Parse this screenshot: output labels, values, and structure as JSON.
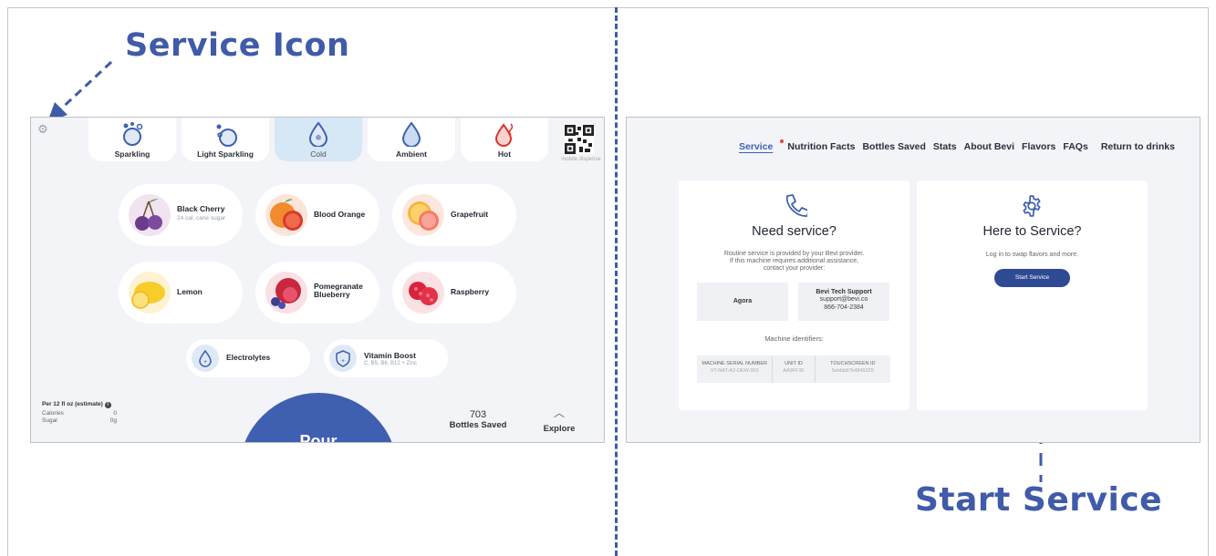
{
  "callouts": {
    "service_icon": "Service Icon",
    "start_service": "Start Service"
  },
  "left_screen": {
    "temperatures": [
      {
        "label": "Sparkling",
        "icon": "sparkling-bubbles-icon"
      },
      {
        "label": "Light Sparkling",
        "icon": "light-sparkling-bubbles-icon"
      },
      {
        "label": "Cold",
        "icon": "cold-drop-icon"
      },
      {
        "label": "Ambient",
        "icon": "ambient-drop-icon"
      },
      {
        "label": "Hot",
        "icon": "hot-drop-icon"
      }
    ],
    "selected_temperature": "Cold",
    "qr_caption": "mobile dispense",
    "flavors": [
      {
        "name": "Black Cherry",
        "sub": "24 cal, cane sugar"
      },
      {
        "name": "Blood Orange",
        "sub": ""
      },
      {
        "name": "Grapefruit",
        "sub": ""
      },
      {
        "name": "Lemon",
        "sub": ""
      },
      {
        "name": "Pomegranate Blueberry",
        "sub": ""
      },
      {
        "name": "Raspberry",
        "sub": ""
      }
    ],
    "boosts": [
      {
        "name": "Electrolytes",
        "sub": ""
      },
      {
        "name": "Vitamin Boost",
        "sub": "C, B5, B6, B12 + Zinc"
      }
    ],
    "nutrition": {
      "header": "Per 12 fl oz (estimate)",
      "rows": [
        {
          "label": "Calories",
          "value": "0"
        },
        {
          "label": "Sugar",
          "value": "0g"
        }
      ]
    },
    "pour_label": "Pour",
    "bottles_saved": {
      "count": "703",
      "label": "Bottles Saved"
    },
    "explore_label": "Explore"
  },
  "right_screen": {
    "nav": [
      "Service",
      "Nutrition Facts",
      "Bottles Saved",
      "Stats",
      "About Bevi",
      "Flavors",
      "FAQs",
      "Return to drinks"
    ],
    "active_nav": "Service",
    "need_service": {
      "title": "Need service?",
      "desc_1": "Routine service is provided by your Bevi provider.",
      "desc_2": "If this machine requires additional assistance,",
      "desc_3": "contact your provider:",
      "provider": "Agora",
      "support_title": "Bevi Tech Support",
      "support_email": "support@bevi.co",
      "support_phone": "866-704-2384",
      "identifiers_label": "Machine identifiers:",
      "identifiers": [
        {
          "header": "MACHINE SERIAL NUMBER",
          "value": "VT-NAT-A2-DEW-902"
        },
        {
          "header": "UNIT ID",
          "value": "AA9FF3F"
        },
        {
          "header": "TOUCHSCREEN ID",
          "value": "5ebbb87b4849325"
        }
      ]
    },
    "here_to_service": {
      "title": "Here to Service?",
      "desc": "Log in to swap flavors and more.",
      "button": "Start Service"
    }
  },
  "colors": {
    "brand_blue": "#3f60b0",
    "callout_blue": "#3f5ba9",
    "alert_red": "#e3443a"
  }
}
